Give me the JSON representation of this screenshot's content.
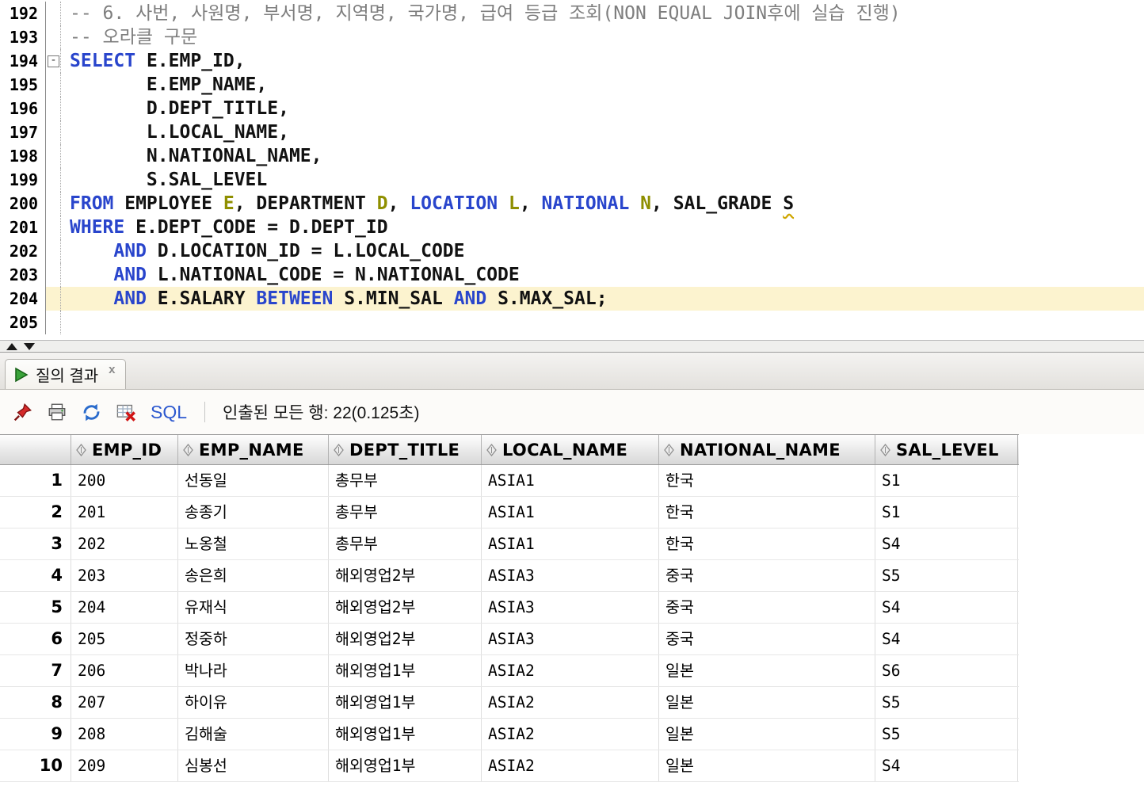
{
  "editor": {
    "lines": [
      {
        "num": "192",
        "segments": [
          {
            "c": "comment",
            "t": "-- 6. 사번, 사원명, 부서명, 지역명, 국가명, 급여 등급 조회(NON EQUAL JOIN후에 실습 진행)"
          }
        ]
      },
      {
        "num": "193",
        "segments": [
          {
            "c": "comment",
            "t": "-- 오라클 구문"
          }
        ]
      },
      {
        "num": "194",
        "fold": true,
        "segments": [
          {
            "c": "kw",
            "t": "SELECT"
          },
          {
            "c": "plain",
            "t": " E.EMP_ID,"
          }
        ]
      },
      {
        "num": "195",
        "segments": [
          {
            "c": "plain",
            "t": "       E.EMP_NAME,"
          }
        ]
      },
      {
        "num": "196",
        "segments": [
          {
            "c": "plain",
            "t": "       D.DEPT_TITLE,"
          }
        ]
      },
      {
        "num": "197",
        "segments": [
          {
            "c": "plain",
            "t": "       L.LOCAL_NAME,"
          }
        ]
      },
      {
        "num": "198",
        "segments": [
          {
            "c": "plain",
            "t": "       N.NATIONAL_NAME,"
          }
        ]
      },
      {
        "num": "199",
        "segments": [
          {
            "c": "plain",
            "t": "       S.SAL_LEVEL"
          }
        ]
      },
      {
        "num": "200",
        "segments": [
          {
            "c": "kw",
            "t": "FROM"
          },
          {
            "c": "plain",
            "t": " EMPLOYEE "
          },
          {
            "c": "alias",
            "t": "E"
          },
          {
            "c": "plain",
            "t": ", DEPARTMENT "
          },
          {
            "c": "alias",
            "t": "D"
          },
          {
            "c": "plain",
            "t": ", "
          },
          {
            "c": "kw",
            "t": "LOCATION"
          },
          {
            "c": "plain",
            "t": " "
          },
          {
            "c": "alias",
            "t": "L"
          },
          {
            "c": "plain",
            "t": ", "
          },
          {
            "c": "kw",
            "t": "NATIONAL"
          },
          {
            "c": "plain",
            "t": " "
          },
          {
            "c": "alias",
            "t": "N"
          },
          {
            "c": "plain",
            "t": ", SAL_GRADE "
          },
          {
            "c": "warn",
            "t": "S"
          }
        ]
      },
      {
        "num": "201",
        "segments": [
          {
            "c": "kw",
            "t": "WHERE"
          },
          {
            "c": "plain",
            "t": " E.DEPT_CODE = D.DEPT_ID"
          }
        ]
      },
      {
        "num": "202",
        "segments": [
          {
            "c": "plain",
            "t": "    "
          },
          {
            "c": "kw",
            "t": "AND"
          },
          {
            "c": "plain",
            "t": " D.LOCATION_ID = L.LOCAL_CODE"
          }
        ]
      },
      {
        "num": "203",
        "segments": [
          {
            "c": "plain",
            "t": "    "
          },
          {
            "c": "kw",
            "t": "AND"
          },
          {
            "c": "plain",
            "t": " L.NATIONAL_CODE = N.NATIONAL_CODE"
          }
        ]
      },
      {
        "num": "204",
        "highlight": true,
        "segments": [
          {
            "c": "plain",
            "t": "    "
          },
          {
            "c": "kw",
            "t": "AND"
          },
          {
            "c": "plain",
            "t": " E.SALARY "
          },
          {
            "c": "kw",
            "t": "BETWEEN"
          },
          {
            "c": "plain",
            "t": " S.MIN_SAL "
          },
          {
            "c": "kw",
            "t": "AND"
          },
          {
            "c": "plain",
            "t": " S.MAX_SAL;"
          }
        ]
      },
      {
        "num": "205",
        "segments": []
      }
    ]
  },
  "results": {
    "tab_label": "질의 결과",
    "tab_close": "x"
  },
  "toolbar": {
    "sql_label": "SQL",
    "status": "인출된 모든 행: 22(0.125초)"
  },
  "grid": {
    "columns": [
      "EMP_ID",
      "EMP_NAME",
      "DEPT_TITLE",
      "LOCAL_NAME",
      "NATIONAL_NAME",
      "SAL_LEVEL"
    ],
    "rows": [
      [
        "1",
        "200",
        "선동일",
        "총무부",
        "ASIA1",
        "한국",
        "S1"
      ],
      [
        "2",
        "201",
        "송종기",
        "총무부",
        "ASIA1",
        "한국",
        "S1"
      ],
      [
        "3",
        "202",
        "노옹철",
        "총무부",
        "ASIA1",
        "한국",
        "S4"
      ],
      [
        "4",
        "203",
        "송은희",
        "해외영업2부",
        "ASIA3",
        "중국",
        "S5"
      ],
      [
        "5",
        "204",
        "유재식",
        "해외영업2부",
        "ASIA3",
        "중국",
        "S4"
      ],
      [
        "6",
        "205",
        "정중하",
        "해외영업2부",
        "ASIA3",
        "중국",
        "S4"
      ],
      [
        "7",
        "206",
        "박나라",
        "해외영업1부",
        "ASIA2",
        "일본",
        "S6"
      ],
      [
        "8",
        "207",
        "하이유",
        "해외영업1부",
        "ASIA2",
        "일본",
        "S5"
      ],
      [
        "9",
        "208",
        "김해술",
        "해외영업1부",
        "ASIA2",
        "일본",
        "S5"
      ],
      [
        "10",
        "209",
        "심봉선",
        "해외영업1부",
        "ASIA2",
        "일본",
        "S4"
      ]
    ]
  }
}
